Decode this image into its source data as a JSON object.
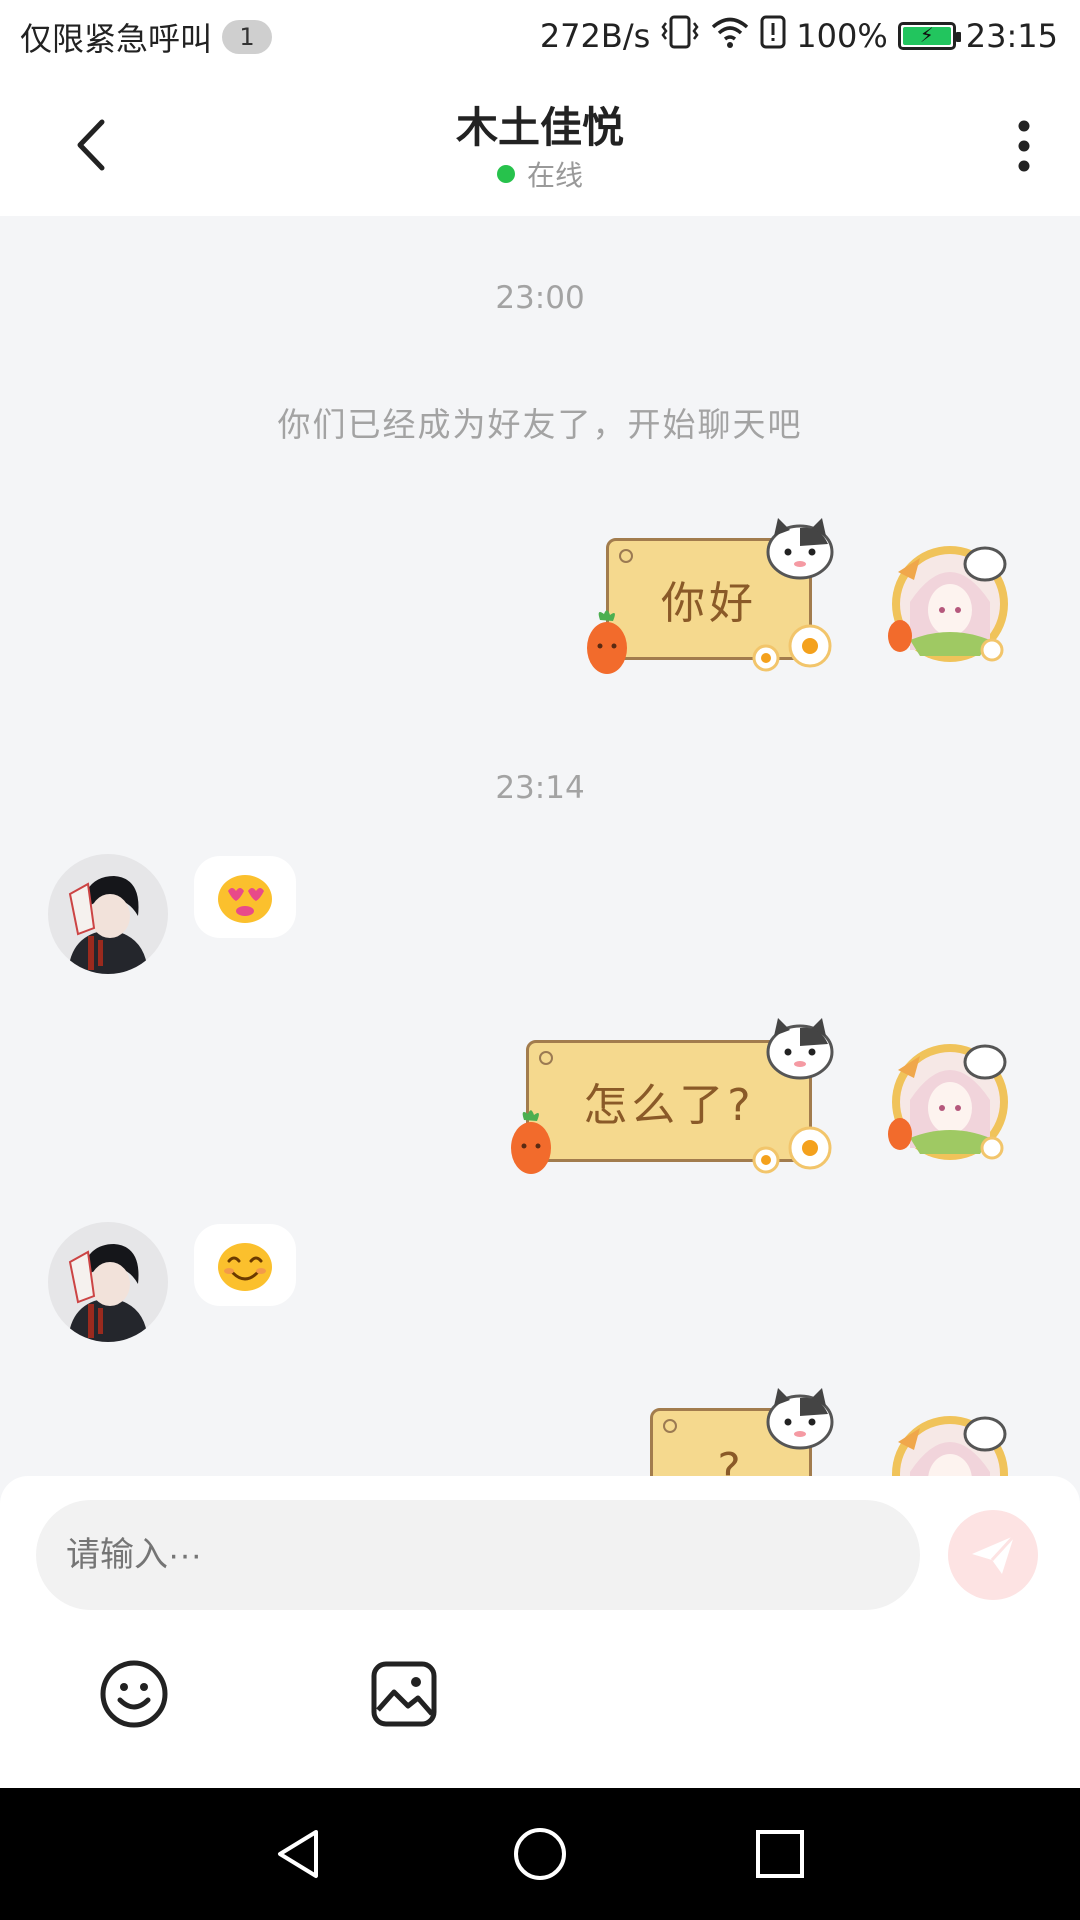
{
  "status_bar": {
    "left_text": "仅限紧急呼叫",
    "badge": "1",
    "net_speed": "272B/s",
    "battery_text": "100%",
    "battery_level": 1.0,
    "time": "23:15",
    "icons": [
      "vibrate-icon",
      "wifi-icon",
      "alert-icon",
      "battery-icon"
    ]
  },
  "header": {
    "title": "木土佳悦",
    "status": "在线",
    "status_color": "#27c24c"
  },
  "chat": {
    "time_1": "23:00",
    "system_message": "你们已经成为好友了，开始聊天吧",
    "time_2": "23:14",
    "messages": [
      {
        "from": "me",
        "text": "你好"
      },
      {
        "from": "friend",
        "emoji": "smiling-face-with-heart-eyes"
      },
      {
        "from": "me",
        "text": "怎么了?"
      },
      {
        "from": "friend",
        "emoji": "smiling-face"
      },
      {
        "from": "me",
        "text": "?"
      }
    ]
  },
  "input": {
    "placeholder": "请输入···",
    "send_color": "#fde3e3"
  },
  "toolbar": {
    "icons": [
      "emoji-icon",
      "image-icon"
    ]
  },
  "navbar": {
    "icons": [
      "back-triangle-icon",
      "home-circle-icon",
      "recents-square-icon"
    ]
  }
}
